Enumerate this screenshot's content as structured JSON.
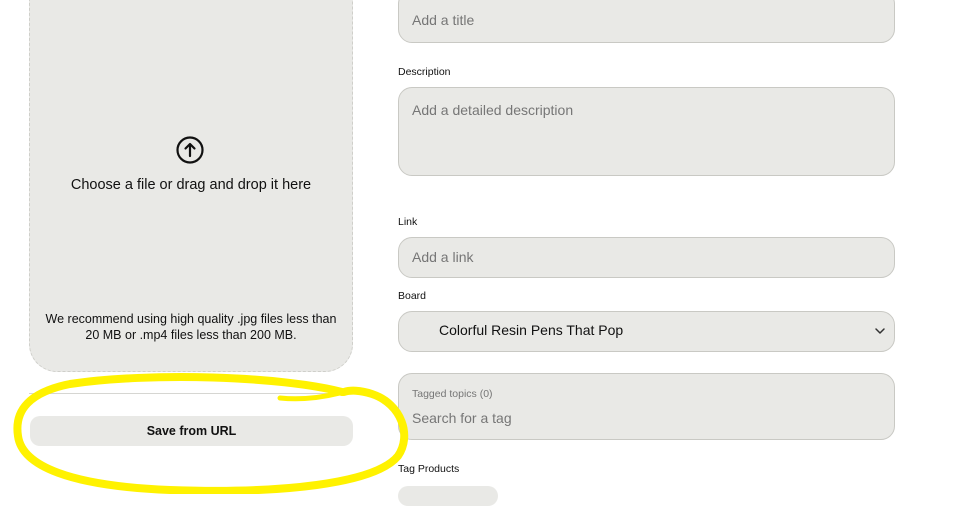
{
  "upload": {
    "icon": "upload-arrow-icon",
    "choose_text": "Choose a file or drag and drop it here",
    "recommendation": "We recommend using high quality .jpg files less than 20 MB or .mp4 files less than 200 MB."
  },
  "save_from_url": {
    "label": "Save from URL"
  },
  "form": {
    "title": {
      "placeholder": "Add a title"
    },
    "description": {
      "label": "Description",
      "placeholder": "Add a detailed description"
    },
    "link": {
      "label": "Link",
      "placeholder": "Add a link"
    },
    "board": {
      "label": "Board",
      "value": "Colorful Resin Pens That Pop",
      "icon": "chevron-down-icon"
    },
    "tagged_topics": {
      "label": "Tagged topics (0)",
      "placeholder": "Search for a tag"
    },
    "tag_products": {
      "label": "Tag Products"
    }
  },
  "annotation": {
    "color": "#fff200"
  }
}
